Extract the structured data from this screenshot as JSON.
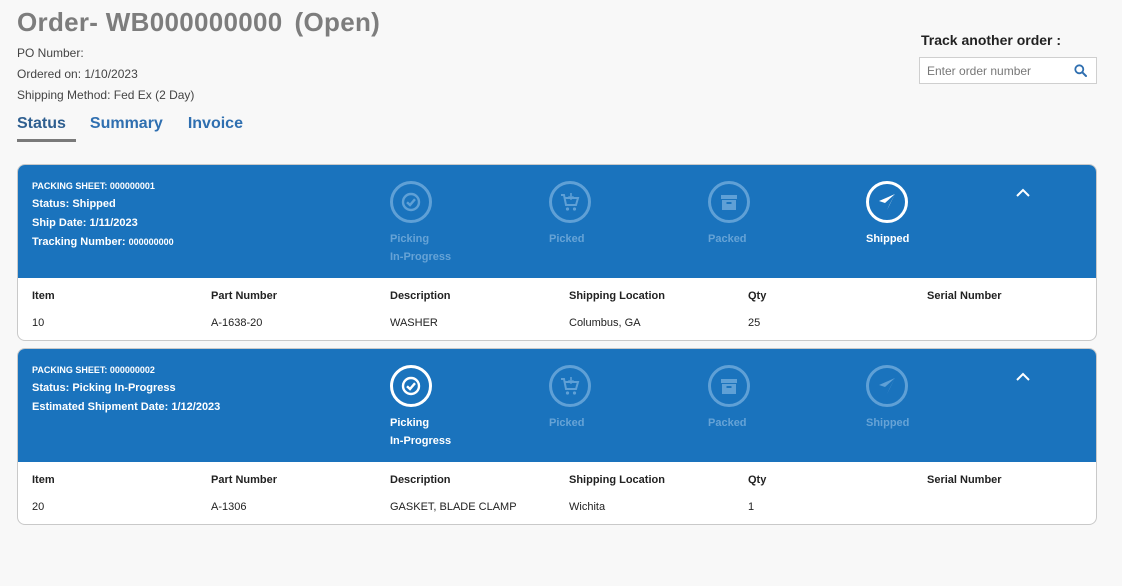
{
  "order": {
    "title": "Order- WB000000000",
    "state": "(Open)",
    "po_number": "PO Number:",
    "ordered_on": "Ordered on: 1/10/2023",
    "shipping_method": "Shipping Method: Fed Ex (2 Day)"
  },
  "track": {
    "label": "Track another order :",
    "placeholder": "Enter order number",
    "icon": "search-icon"
  },
  "tabs": [
    {
      "label": "Status"
    },
    {
      "label": "Summary"
    },
    {
      "label": "Invoice"
    }
  ],
  "columns": [
    "Item",
    "Part Number",
    "Description",
    "Shipping Location",
    "Qty",
    "Serial Number"
  ],
  "steps": [
    {
      "line1": "Picking",
      "line2": "In-Progress",
      "icon": "check-circle-icon"
    },
    {
      "line1": "Picked",
      "line2": "",
      "icon": "cart-icon"
    },
    {
      "line1": "Packed",
      "line2": "",
      "icon": "box-icon"
    },
    {
      "line1": "Shipped",
      "line2": "",
      "icon": "airplane-icon"
    }
  ],
  "packing_sheets": [
    {
      "sheet_label": "PACKING SHEET:",
      "sheet_number": "000000001",
      "status": "Status: Shipped",
      "date": "Ship Date: 1/11/2023",
      "tracking_label": "Tracking Number:",
      "tracking_number": "000000000",
      "current_step": 3,
      "row": {
        "item": "10",
        "part_number": "A-1638-20",
        "description": "WASHER",
        "location": "Columbus, GA",
        "qty": "25",
        "serial": ""
      }
    },
    {
      "sheet_label": "PACKING SHEET:",
      "sheet_number": "000000002",
      "status": "Status: Picking In-Progress",
      "date": "Estimated Shipment Date: 1/12/2023",
      "current_step": 0,
      "row": {
        "item": "20",
        "part_number": "A-1306",
        "description": "GASKET, BLADE CLAMP",
        "location": "Wichita",
        "qty": "1",
        "serial": ""
      }
    }
  ],
  "colors": {
    "accent": "#1a73bd",
    "tab_text": "#2f6fb0"
  }
}
